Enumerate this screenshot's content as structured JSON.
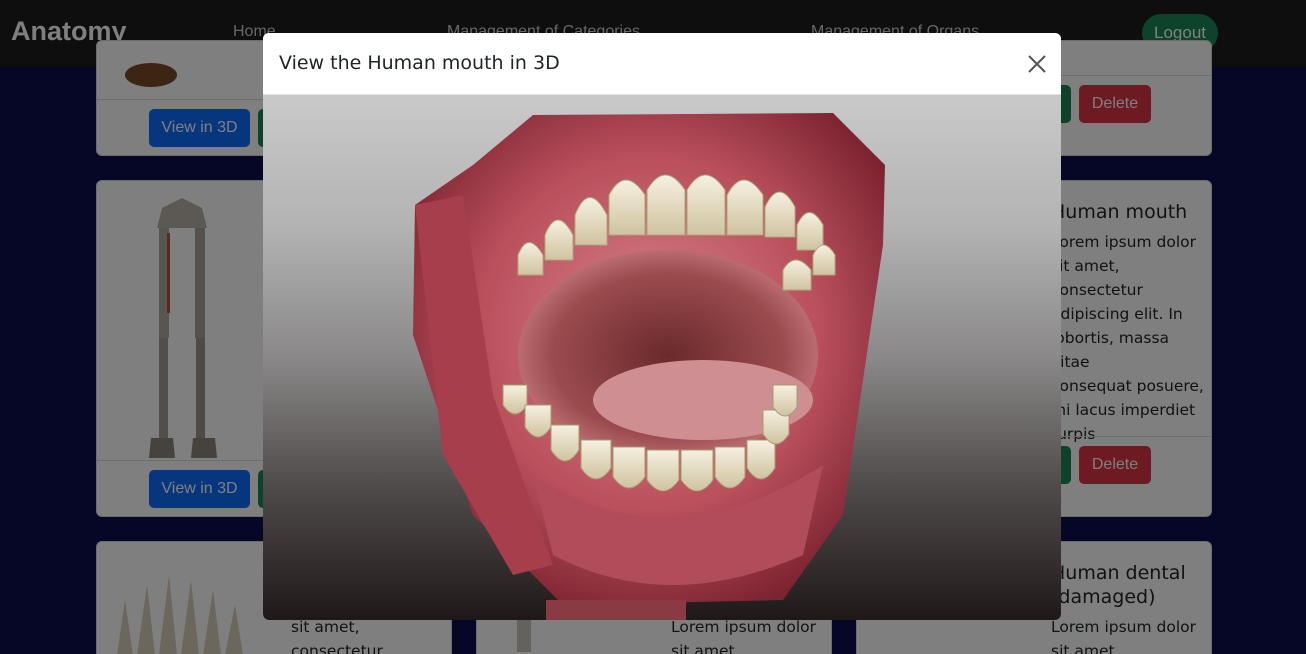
{
  "navbar": {
    "brand": "Anatomy",
    "links": [
      "Home",
      "Management of Categories",
      "Management of Organs"
    ],
    "logout_label": "Logout"
  },
  "cards": {
    "view_label": "View in 3D",
    "delete_label": "Delete",
    "mouth_title": "Human mouth",
    "mouth_text_lines": [
      "Lorem ipsum dolor",
      "sit amet,",
      "consectetur",
      "adipiscing elit. In",
      "lobortis, massa vitae",
      "consequat posuere,",
      "mi lacus imperdiet",
      "turpis"
    ],
    "dental_title_lines": [
      "Human dental",
      "(damaged)"
    ],
    "row3_text_left": [
      "sit amet,",
      "consectetur"
    ],
    "row3_text_mid": [
      "Lorem ipsum dolor",
      "sit amet"
    ],
    "row3_text_right": [
      "Lorem ipsum dolor",
      "sit amet"
    ]
  },
  "modal": {
    "title": "View the Human mouth in 3D",
    "close_icon": "close-icon",
    "viewer_subject": "3d-mouth-model"
  },
  "colors": {
    "primary": "#0d6efd",
    "success": "#198754",
    "danger": "#dc3545",
    "page_bg": "#0c0c4c",
    "navbar_bg": "#1c1c1c"
  }
}
